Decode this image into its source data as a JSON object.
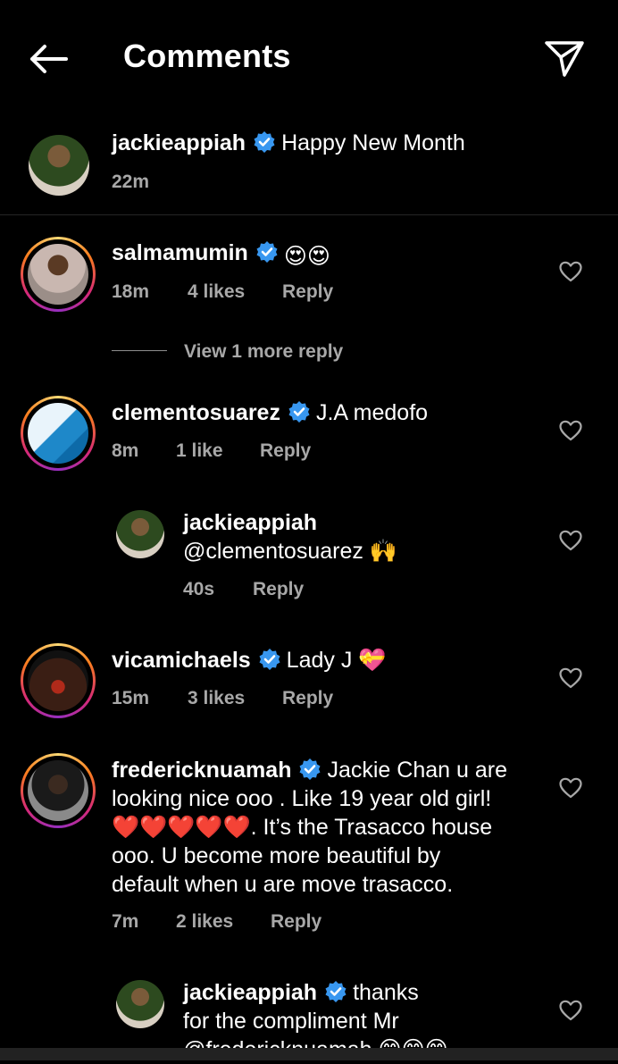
{
  "header": {
    "title": "Comments",
    "back_icon": "back-arrow-icon",
    "send_icon": "paper-plane-icon"
  },
  "post": {
    "username": "jackieappiah",
    "caption": "Happy New Month",
    "time": "22m"
  },
  "comments": [
    {
      "username": "salmamumin",
      "text": "😍😍",
      "time": "18m",
      "likes": "4 likes",
      "reply": "Reply",
      "view_more": "View 1 more reply"
    },
    {
      "username": "clementosuarez",
      "text": "J.A medofo",
      "time": "8m",
      "likes": "1 like",
      "reply": "Reply"
    },
    {
      "username": "jackieappiah",
      "text": "@clementosuarez 🙌",
      "time": "40s",
      "reply": "Reply"
    },
    {
      "username": "vicamichaels",
      "text": "Lady J 💝",
      "time": "15m",
      "likes": "3 likes",
      "reply": "Reply"
    },
    {
      "username": "fredericknuamah",
      "lines": [
        "Jackie Chan u are",
        "looking nice ooo . Like 19 year old  girl!",
        "❤️❤️❤️❤️❤️. It’s the Trasacco house",
        "ooo. U become more beautiful by",
        "default when u are move trasacco."
      ],
      "time": "7m",
      "likes": "2 likes",
      "reply": "Reply"
    },
    {
      "username": "jackieappiah",
      "lines": [
        "thanks",
        "for the compliment Mr",
        "@fredericknuamah 😊😊😊"
      ]
    }
  ],
  "colors": {
    "background": "#000000",
    "meta": "#a8a8a8",
    "verified": "#3897f0",
    "divider": "#262626"
  }
}
